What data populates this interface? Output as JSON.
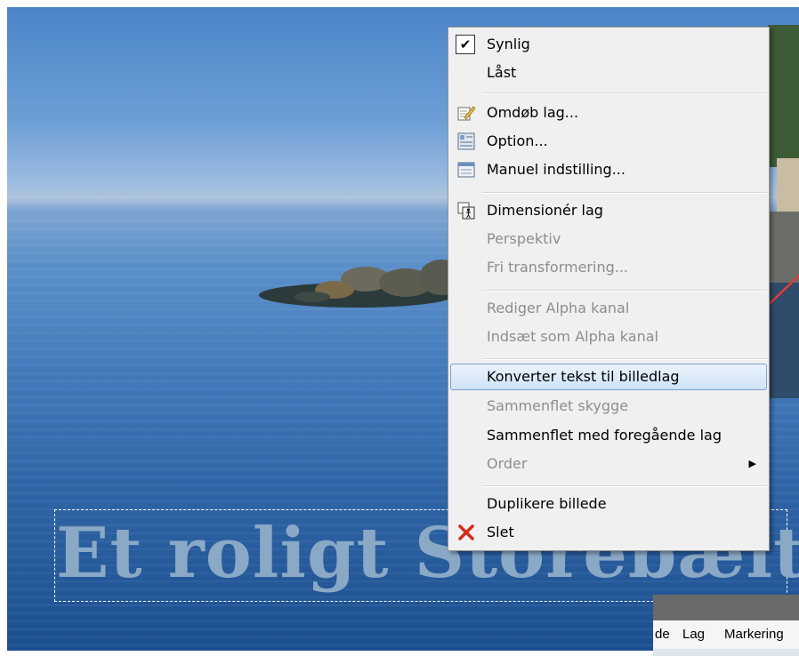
{
  "banner": {
    "text": "Et roligt Storebælt"
  },
  "context_menu": {
    "items": [
      {
        "label": "Synlig",
        "checked": true
      },
      {
        "label": "Låst"
      },
      {
        "label": "Omdøb lag...",
        "icon": "rename-icon"
      },
      {
        "label": "Option...",
        "icon": "option-icon"
      },
      {
        "label": "Manuel indstilling...",
        "icon": "manual-settings-icon"
      },
      {
        "label": "Dimensionér lag",
        "icon": "resize-layer-icon"
      },
      {
        "label": "Perspektiv",
        "disabled": true
      },
      {
        "label": "Fri transformering...",
        "disabled": true
      },
      {
        "label": "Rediger Alpha kanal",
        "disabled": true
      },
      {
        "label": "Indsæt som Alpha kanal",
        "disabled": true
      },
      {
        "label": "Konverter tekst til billedlag",
        "highlighted": true
      },
      {
        "label": "Sammenflet skygge",
        "disabled": true
      },
      {
        "label": "Sammenflet med foregående lag"
      },
      {
        "label": "Order",
        "disabled": true,
        "submenu": true
      },
      {
        "label": "Duplikere billede"
      },
      {
        "label": "Slet",
        "icon": "delete-x-icon"
      }
    ]
  },
  "app_menubar": {
    "items": [
      "de",
      "Lag",
      "Markering"
    ]
  },
  "colors": {
    "highlight_border": "#7da2ce",
    "arrow": "#e53b3b",
    "delete_x": "#d9281c"
  }
}
